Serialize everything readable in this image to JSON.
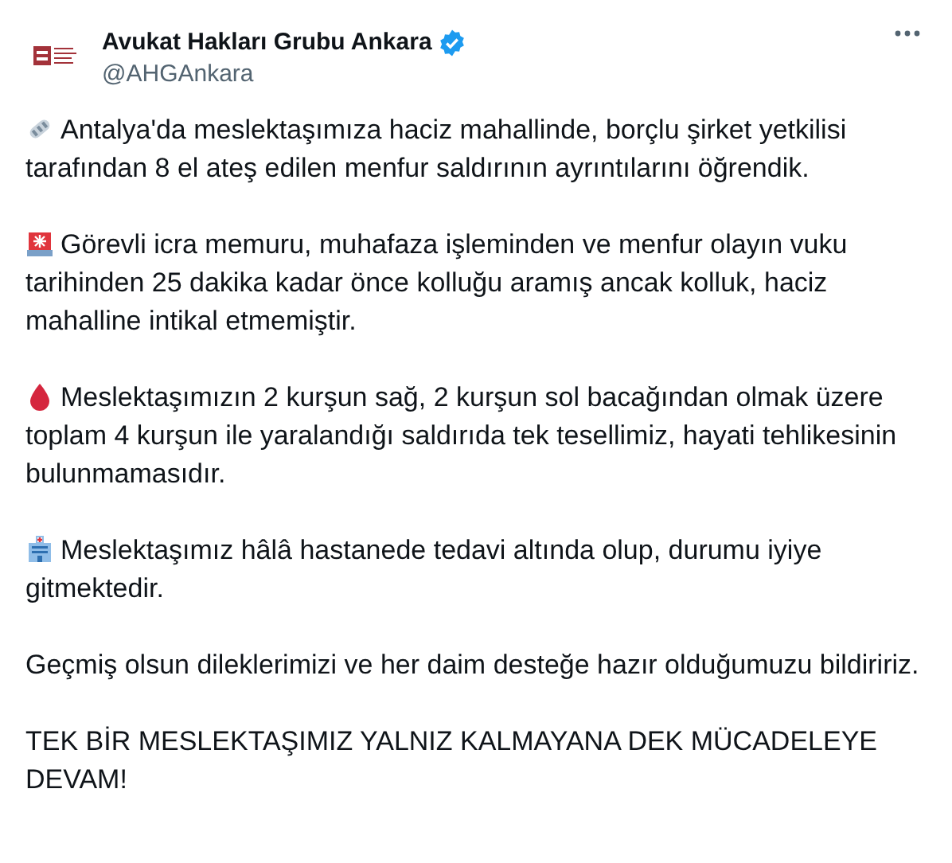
{
  "author": {
    "name": "Avukat Hakları Grubu Ankara",
    "verified": true,
    "handle": "@AHGAnkara"
  },
  "paragraphs": [
    {
      "kind": "newspaper",
      "text": "Antalya'da meslektaşımıza haciz mahallinde, borçlu şirket yetkilisi tarafından 8 el ateş edilen menfur saldırının ayrıntılarını öğrendik."
    },
    {
      "kind": "siren",
      "text": "Görevli icra memuru, muhafaza işleminden ve menfur olayın vuku tarihinden 25 dakika kadar önce kolluğu aramış ancak kolluk, haciz mahalline intikal etmemiştir."
    },
    {
      "kind": "drop",
      "text": "Meslektaşımızın 2 kurşun sağ, 2 kurşun sol bacağından olmak üzere toplam 4 kurşun ile yaralandığı saldırıda tek tesellimiz, hayati tehlikesinin bulunmamasıdır."
    },
    {
      "kind": "hospital",
      "text": "Meslektaşımız hâlâ hastanede tedavi altında olup, durumu iyiye gitmektedir."
    },
    {
      "text": "Geçmiş olsun dileklerimizi ve her daim desteğe hazır olduğumuzu bildiririz."
    },
    {
      "text": "TEK BİR MESLEKTAŞIMIZ YALNIZ KALMAYANA DEK MÜCADELEYE DEVAM!"
    }
  ]
}
